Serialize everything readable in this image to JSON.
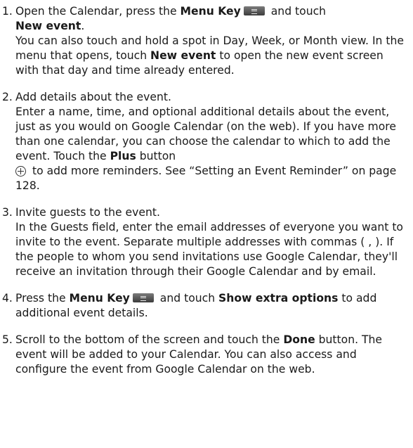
{
  "steps": [
    {
      "number": "1.",
      "lead": {
        "a": "Open the Calendar, press the ",
        "key": "Menu Key",
        "b": " and touch ",
        "target": "New event",
        "c": "."
      },
      "detail": {
        "a": "You can also touch and hold a spot in Day, Week, or Month view. In the menu that opens, touch ",
        "target": "New event",
        "b": " to open the new event screen with that day and time already entered."
      }
    },
    {
      "number": "2.",
      "lead": "Add details about the event.",
      "detail": {
        "a": "Enter a name, time, and optional additional details about the event, just as you would on Google Calendar (on the web). If you have more than one calendar, you can choose the calendar to which to add the event. Touch the ",
        "target": "Plus",
        "b": " button",
        "c": " to add more reminders. See “Setting an Event Reminder” on page 128."
      }
    },
    {
      "number": "3.",
      "lead": "Invite guests to the event.",
      "detail": "In the Guests field, enter the email addresses of everyone you want to invite to the event. Separate multiple addresses with commas ( , ). If the people to whom you send invitations use Google Calendar, they'll receive an invitation through their Google Calendar and by email."
    },
    {
      "number": "4.",
      "lead": {
        "a": "Press the ",
        "key": "Menu Key",
        "b": " and touch ",
        "target": "Show extra options",
        "c": " to add additional event details."
      }
    },
    {
      "number": "5.",
      "lead": {
        "a": "Scroll to the bottom of the screen and touch the ",
        "target": "Done",
        "b": " button. The event will be added to your Calendar. You can also access and configure the event from Google Calendar on the web."
      }
    }
  ],
  "icons": {
    "menu_key": "menu-key-icon",
    "plus_button": "plus-circle-icon"
  }
}
